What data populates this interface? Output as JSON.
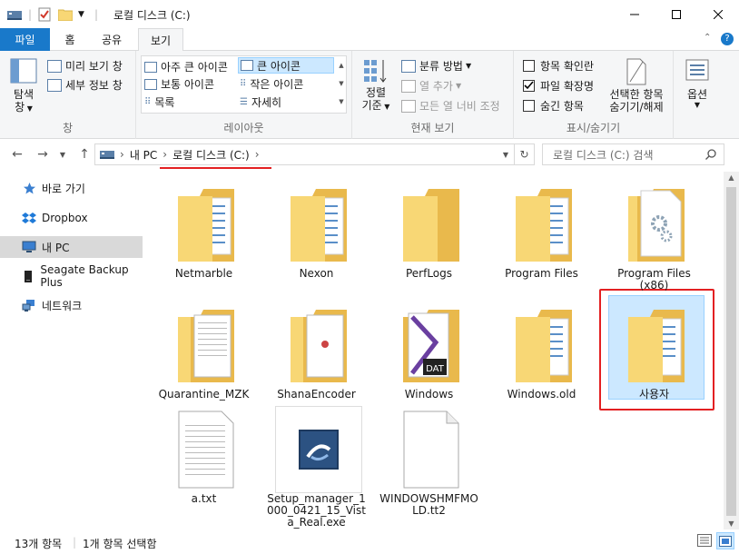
{
  "window": {
    "title": "로컬 디스크 (C:)",
    "minimize_icon": "minimize-icon",
    "maximize_icon": "maximize-icon",
    "close_icon": "close-icon"
  },
  "tabs": {
    "file": "파일",
    "home": "홈",
    "share": "공유",
    "view": "보기"
  },
  "ribbon": {
    "panes": {
      "nav_pane_line1": "탐색",
      "nav_pane_line2": "창",
      "preview": "미리 보기 창",
      "details": "세부 정보 창",
      "label": "창"
    },
    "layout": {
      "xl_icons": "아주 큰 아이콘",
      "large_icons": "큰 아이콘",
      "medium_icons": "보통 아이콘",
      "small_icons": "작은 아이콘",
      "list": "목록",
      "details": "자세히",
      "label": "레이아웃"
    },
    "current_view": {
      "sort_line1": "정렬",
      "sort_line2": "기준",
      "group_by": "분류 방법",
      "add_columns": "열 추가",
      "fit_columns": "모든 열 너비 조정",
      "label": "현재 보기"
    },
    "show_hide": {
      "item_checkboxes": "항목 확인란",
      "file_extensions": "파일 확장명",
      "hidden_items": "숨긴 항목",
      "hide_selected_line1": "선택한 항목",
      "hide_selected_line2": "숨기기/해제",
      "label": "표시/숨기기",
      "item_checkboxes_checked": false,
      "file_extensions_checked": true,
      "hidden_items_checked": false
    },
    "options": "옵션"
  },
  "address": {
    "crumbs": [
      "내 PC",
      "로컬 디스크 (C:)"
    ],
    "search_placeholder": "로컬 디스크 (C:) 검색"
  },
  "navpane": {
    "items": [
      {
        "label": "바로 가기",
        "icon": "star-icon"
      },
      {
        "label": "Dropbox",
        "icon": "dropbox-icon"
      },
      {
        "label": "내 PC",
        "icon": "computer-icon"
      },
      {
        "label": "Seagate Backup Plus",
        "icon": "drive-icon"
      },
      {
        "label": "네트워크",
        "icon": "network-icon"
      }
    ]
  },
  "files": [
    {
      "label": "Netmarble",
      "type": "folder-docs"
    },
    {
      "label": "Nexon",
      "type": "folder-docs"
    },
    {
      "label": "PerfLogs",
      "type": "folder-empty"
    },
    {
      "label": "Program Files",
      "type": "folder-docs"
    },
    {
      "label": "Program Files (x86)",
      "type": "folder-gear"
    },
    {
      "label": "Quarantine_MZK",
      "type": "folder-pages"
    },
    {
      "label": "ShanaEncoder",
      "type": "folder-pages"
    },
    {
      "label": "Windows",
      "type": "folder-dat"
    },
    {
      "label": "Windows.old",
      "type": "folder-docs"
    },
    {
      "label": "사용자",
      "type": "folder-docs"
    },
    {
      "label": "a.txt",
      "type": "text-file"
    },
    {
      "label": "Setup_manager_1000_0421_15_Vista_Real.exe",
      "type": "exe-file"
    },
    {
      "label": "WINDOWSHMFMOLD.tt2",
      "type": "blank-file"
    }
  ],
  "status": {
    "count": "13개 항목",
    "selection": "1개 항목 선택함"
  },
  "colors": {
    "accent": "#1979ca",
    "selection": "#cce8ff",
    "highlight_red": "#e32022",
    "folder": "#f8d775"
  }
}
